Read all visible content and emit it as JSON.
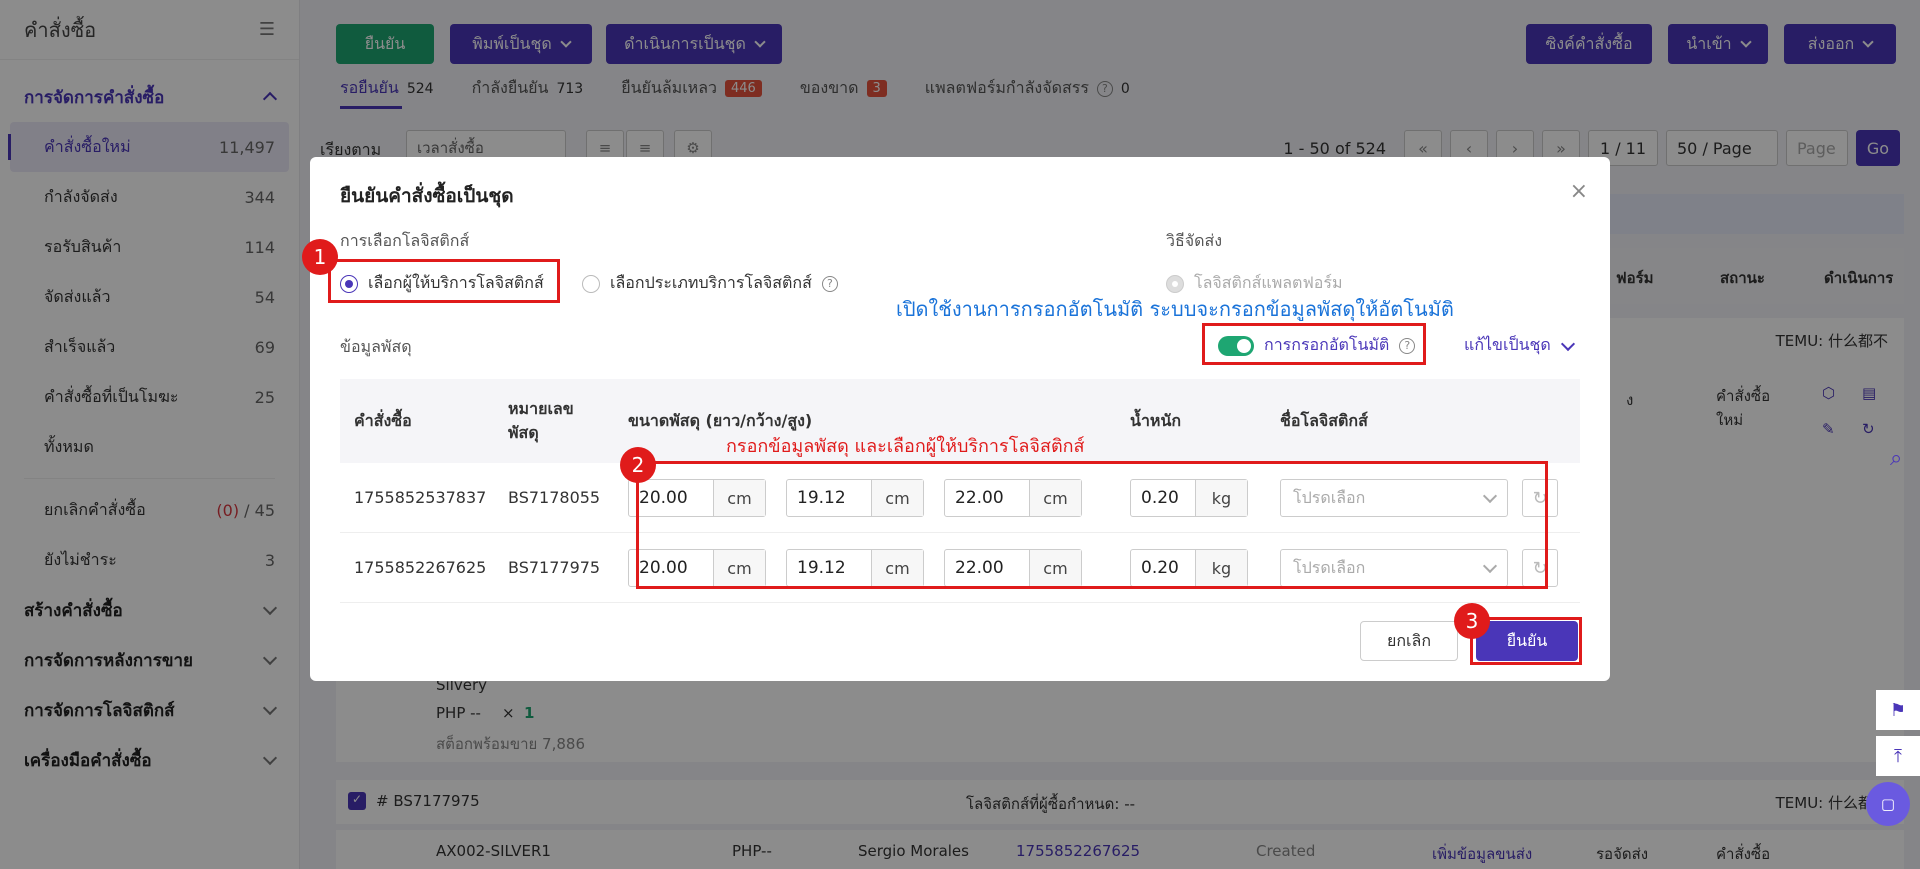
{
  "sidebar": {
    "title": "คำสั่งซื้อ",
    "group_active": "การจัดการคำสั่งซื้อ",
    "items": [
      {
        "label": "คำสั่งซื้อใหม่",
        "count": "11,497"
      },
      {
        "label": "กำลังจัดส่ง",
        "count": "344"
      },
      {
        "label": "รอรับสินค้า",
        "count": "114"
      },
      {
        "label": "จัดส่งแล้ว",
        "count": "54"
      },
      {
        "label": "สำเร็จแล้ว",
        "count": "69"
      },
      {
        "label": "คำสั่งซื้อที่เป็นโมฆะ",
        "count": "25"
      },
      {
        "label": "ทั้งหมด",
        "count": ""
      }
    ],
    "cancel_item": {
      "label": "ยกเลิกคำสั่งซื้อ",
      "count_red": "(0)",
      "count": "/ 45"
    },
    "unpaid_item": {
      "label": "ยังไม่ชำระ",
      "count": "3"
    },
    "groups": [
      "สร้างคำสั่งซื้อ",
      "การจัดการหลังการขาย",
      "การจัดการโลจิสติกส์",
      "เครื่องมือคำสั่งซื้อ"
    ]
  },
  "toolbar": {
    "confirm": "ยืนยัน",
    "print_batch": "พิมพ์เป็นชุด",
    "process_batch": "ดำเนินการเป็นชุด",
    "sync": "ซิงค์คำสั่งซื้อ",
    "import": "นำเข้า",
    "export": "ส่งออก"
  },
  "tabs": [
    {
      "label": "รอยืนยัน",
      "num": "524"
    },
    {
      "label": "กำลังยืนยัน",
      "num": "713"
    },
    {
      "label": "ยืนยันล้มเหลว",
      "badge": "446"
    },
    {
      "label": "ของขาด",
      "badge": "3"
    },
    {
      "label": "แพลตฟอร์มกำลังจัดสรร",
      "num": "0"
    }
  ],
  "sort": {
    "label": "เรียงตาม",
    "value": "เวลาสั่งซื้อ",
    "range": "1 - 50 of 524",
    "page": "1 / 11",
    "per_page": "50 / Page",
    "page_placeholder": "Page",
    "go": "Go"
  },
  "background": {
    "col_status": "สถานะ",
    "col_action": "ดำเนินการ",
    "col_platform": "ฟอร์ม",
    "temu_1": "TEMU: 什么都不",
    "temu_2": "TEMU: 什么都不",
    "order_new": "คำสั่งซื้อใหม่",
    "product_silvery": "Silvery",
    "product_price": "PHP --",
    "product_qty_x": "×",
    "product_qty": "1",
    "stock": "สต็อกพร้อมขาย 7,886",
    "pkg2_no": "# BS7177975",
    "pkg2_logistics": "โลจิสติกส์ที่ผู้ซื้อกำหนด: --",
    "row2_sku": "AX002-SILVER1",
    "row2_price": "PHP--",
    "row2_buyer": "Sergio Morales",
    "row2_order": "1755852267625",
    "row2_status": "Created",
    "row2_add": "เพิ่มข้อมูลขนส่ง",
    "row2_wait": "รอจัดส่ง",
    "row2_order_col": "คำสั่งซื้อ",
    "row1_side": "ง"
  },
  "modal": {
    "title": "ยืนยันคำสั่งซื้อเป็นชุด",
    "logistics_select_label": "การเลือกโลจิสติกส์",
    "radio_provider": "เลือกผู้ให้บริการโลจิสติกส์",
    "radio_type": "เลือกประเภทบริการโลจิสติกส์",
    "shipping_method_label": "วิธีจัดส่ง",
    "radio_platform": "โลจิสติกส์แพลตฟอร์ม",
    "parcel_info_label": "ข้อมูลพัสดุ",
    "auto_fill": "การกรอกอัตโนมัติ",
    "batch_edit": "แก้ไขเป็นชุด",
    "columns": {
      "order": "คำสั่งซื้อ",
      "parcel_no_1": "หมายเลข",
      "parcel_no_2": "พัสดุ",
      "size": "ขนาดพัสดุ (ยาว/กว้าง/สูง)",
      "weight": "น้ำหนัก",
      "logistics_name": "ชื่อโลจิสติกส์"
    },
    "rows": [
      {
        "order": "1755852537837",
        "parcel": "BS7178055",
        "l": "20.00",
        "w": "19.12",
        "h": "22.00",
        "weight": "0.20"
      },
      {
        "order": "1755852267625",
        "parcel": "BS7177975",
        "l": "20.00",
        "w": "19.12",
        "h": "22.00",
        "weight": "0.20"
      }
    ],
    "unit_cm": "cm",
    "unit_kg": "kg",
    "select_placeholder": "โปรดเลือก",
    "cancel": "ยกเลิก",
    "confirm": "ยืนยัน"
  },
  "annotations": {
    "n1": "1",
    "n2": "2",
    "n3": "3",
    "blue_note": "เปิดใช้งานการกรอกอัตโนมัติ ระบบจะกรอกข้อมูลพัสดุให้อัตโนมัติ",
    "red_note": "กรอกข้อมูลพัสดุ และเลือกผู้ให้บริการโลจิสติกส์"
  },
  "colors": {
    "brand": "#4a36b8",
    "green": "#1ea672",
    "annotation_red": "#e01b1b",
    "annotation_blue": "#1a73d9"
  }
}
